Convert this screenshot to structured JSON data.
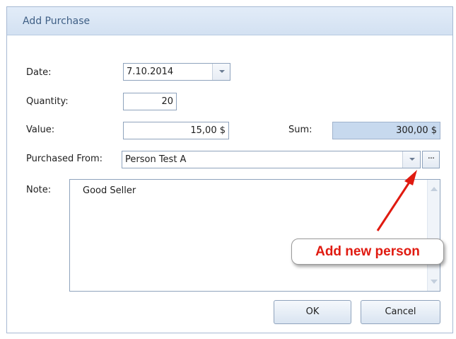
{
  "window": {
    "title": "Add Purchase"
  },
  "form": {
    "date_label": "Date:",
    "date_value": "7.10.2014",
    "quantity_label": "Quantity:",
    "quantity_value": "20",
    "value_label": "Value:",
    "value_value": "15,00 $",
    "sum_label": "Sum:",
    "sum_value": "300,00 $",
    "purchased_from_label": "Purchased From:",
    "purchased_from_value": "Person Test A",
    "ellipsis_label": "···",
    "note_label": "Note:",
    "note_value": "Good Seller"
  },
  "buttons": {
    "ok": "OK",
    "cancel": "Cancel"
  },
  "annotation": {
    "text": "Add new person",
    "color": "#e01a10"
  },
  "colors": {
    "readonly_field": "#c7d9ee",
    "titlebar": "#d3e1f2"
  }
}
